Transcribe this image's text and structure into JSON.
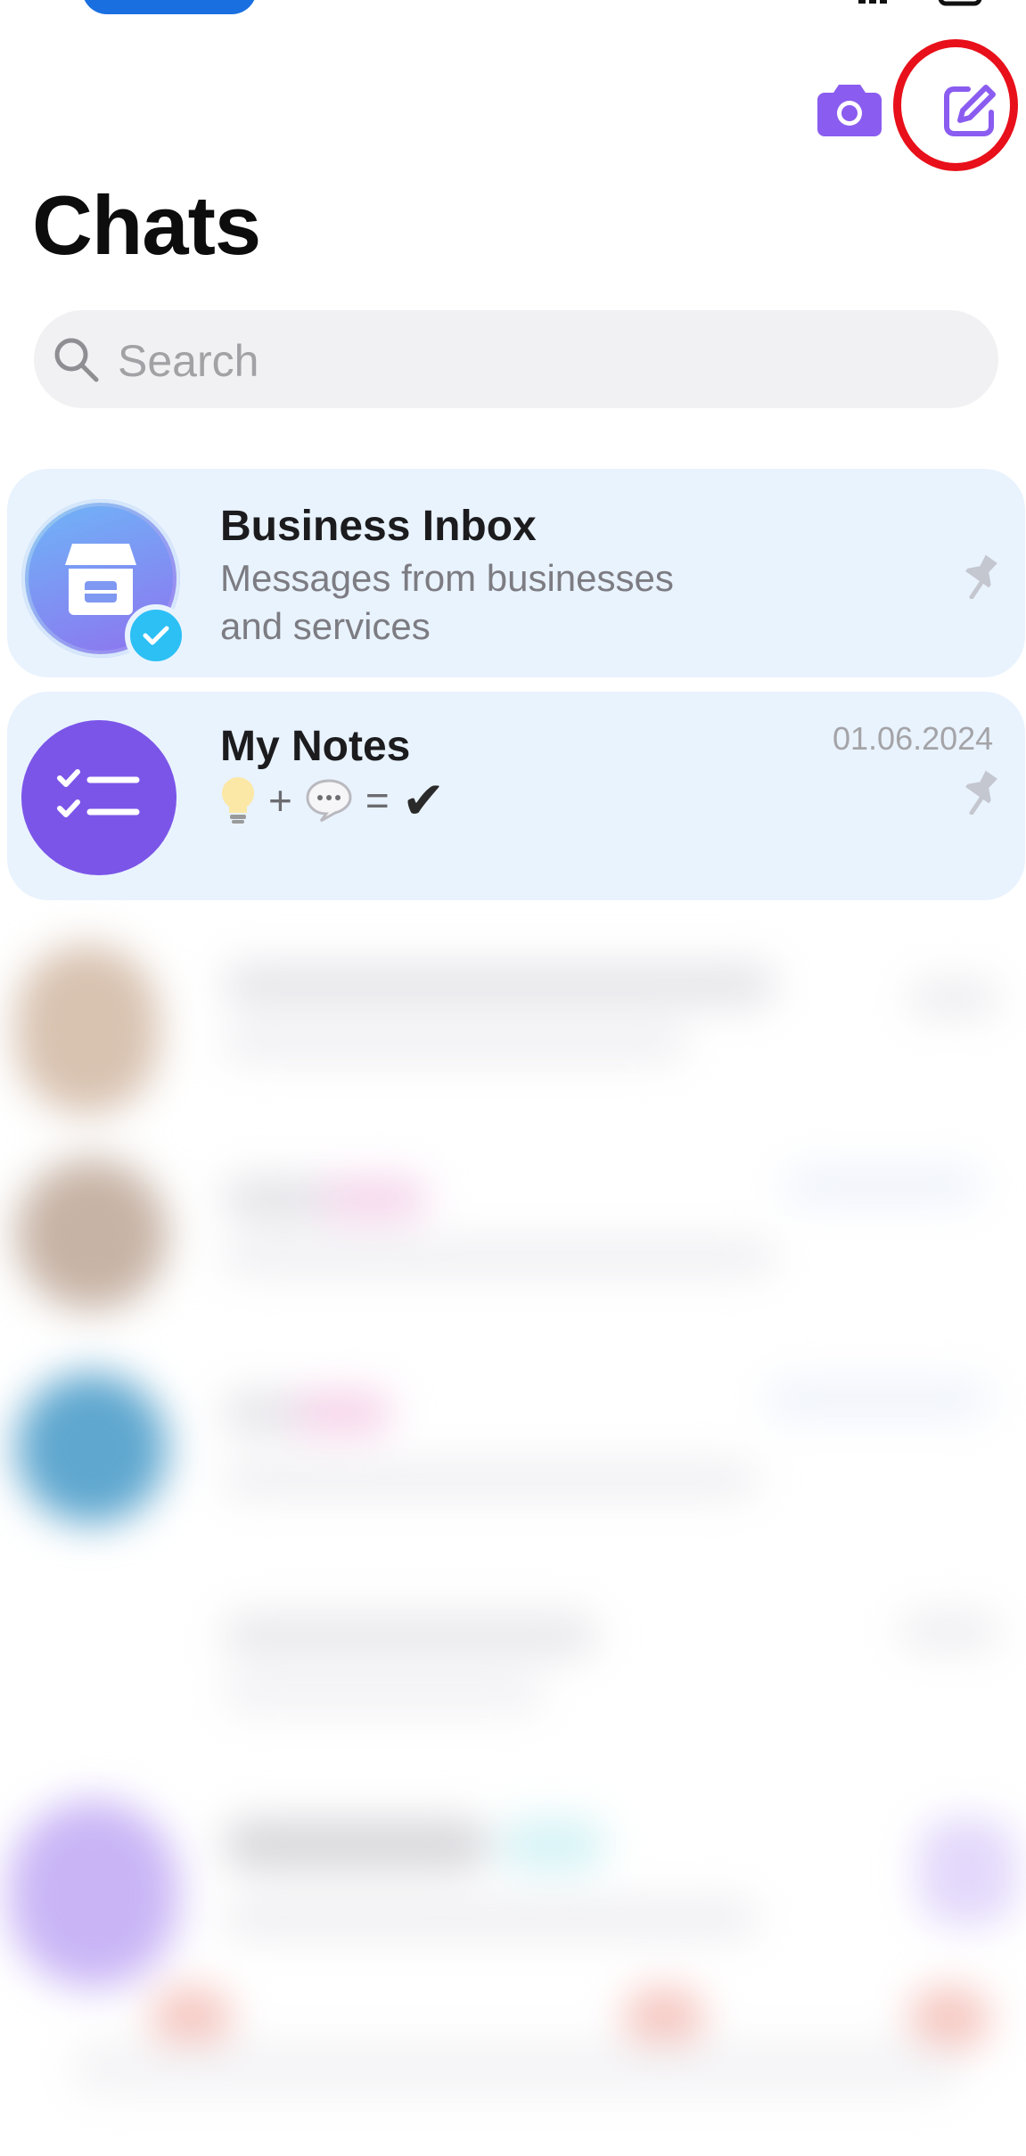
{
  "header": {
    "title": "Chats"
  },
  "search": {
    "placeholder": "Search"
  },
  "chats": [
    {
      "name": "Business Inbox",
      "message_line1": "Messages from businesses",
      "message_line2": "and services",
      "pinned": true,
      "verified": true
    },
    {
      "name": "My Notes",
      "message_plus": "+",
      "message_equals": "=",
      "message_check": "✔",
      "date": "01.06.2024",
      "pinned": true
    }
  ],
  "colors": {
    "accent": "#7b55e8",
    "card_bg": "#e9f3fe",
    "highlight_ring": "#e8101a",
    "verified": "#2cc0f5"
  },
  "icons": [
    "camera-icon",
    "compose-icon",
    "search-icon",
    "store-icon",
    "verified-check-icon",
    "checklist-icon",
    "lightbulb-icon",
    "speech-bubble-icon",
    "pin-icon"
  ]
}
